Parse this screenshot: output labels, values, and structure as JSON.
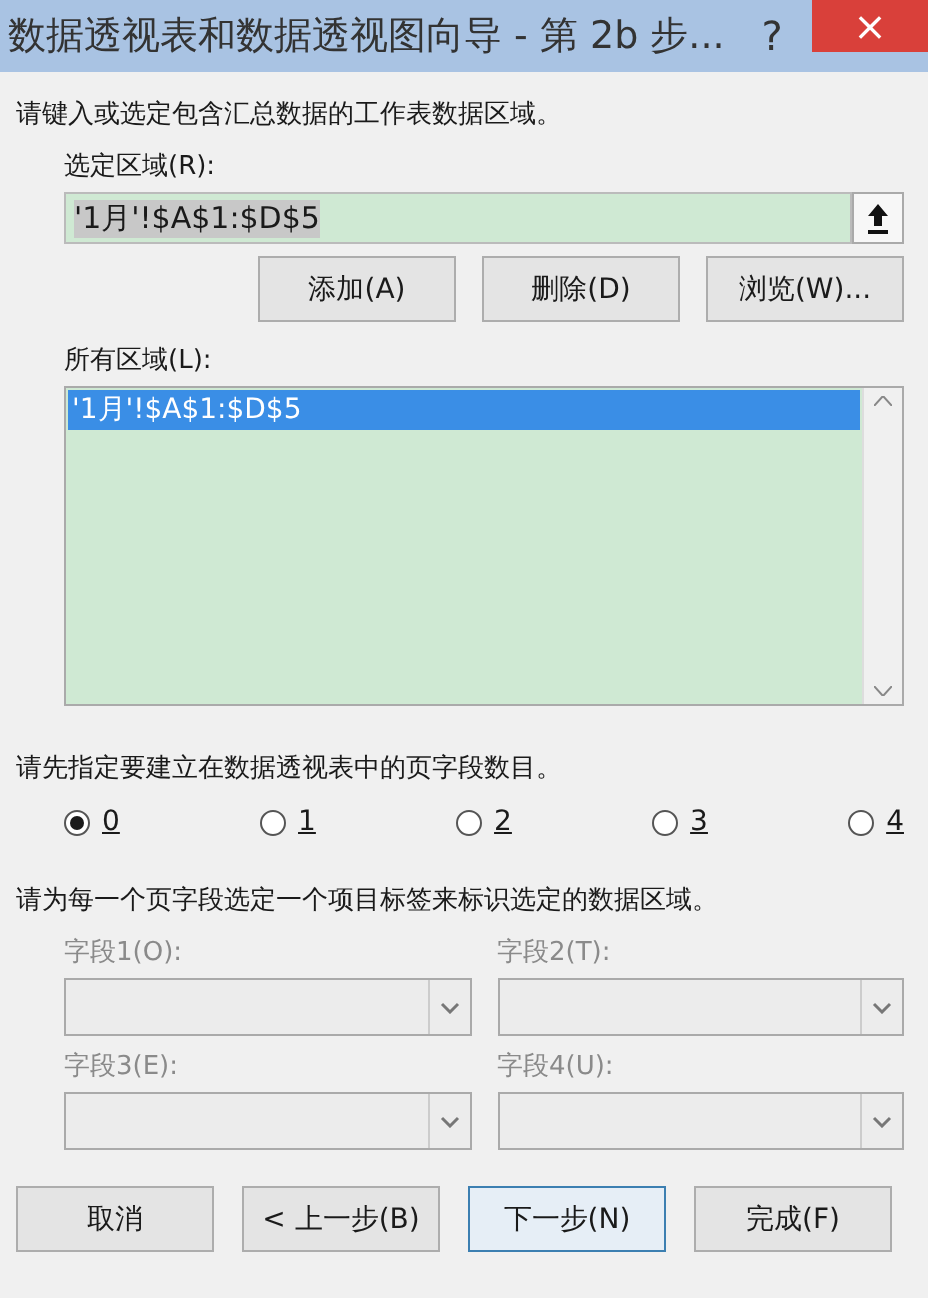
{
  "window": {
    "title": "数据透视表和数据透视图向导 - 第 2b 步...",
    "help": "?",
    "close": "×"
  },
  "range_prompt": "请键入或选定包含汇总数据的工作表数据区域。",
  "selected_range": {
    "label": "选定区域(R):",
    "value": "'1月'!$A$1:$D$5"
  },
  "range_buttons": [
    "添加(A)",
    "删除(D)",
    "浏览(W)..."
  ],
  "all_ranges": {
    "label": "所有区域(L):",
    "items": [
      {
        "text": "'1月'!$A$1:$D$5",
        "selected": true
      }
    ]
  },
  "page_field_prompt": "请先指定要建立在数据透视表中的页字段数目。",
  "page_field_counts": [
    {
      "label": "0",
      "selected": true
    },
    {
      "label": "1",
      "selected": false
    },
    {
      "label": "2",
      "selected": false
    },
    {
      "label": "3",
      "selected": false
    },
    {
      "label": "4",
      "selected": false
    }
  ],
  "item_label_prompt": "请为每一个页字段选定一个项目标签来标识选定的数据区域。",
  "fields": [
    {
      "label": "字段1(O):",
      "disabled": true
    },
    {
      "label": "字段2(T):",
      "disabled": true
    },
    {
      "label": "字段3(E):",
      "disabled": true
    },
    {
      "label": "字段4(U):",
      "disabled": true
    }
  ],
  "buttons": [
    {
      "label": "取消",
      "focused": false
    },
    {
      "label": "< 上一步(B)",
      "focused": false
    },
    {
      "label": "下一步(N)",
      "focused": true
    },
    {
      "label": "完成(F)",
      "focused": false
    }
  ]
}
